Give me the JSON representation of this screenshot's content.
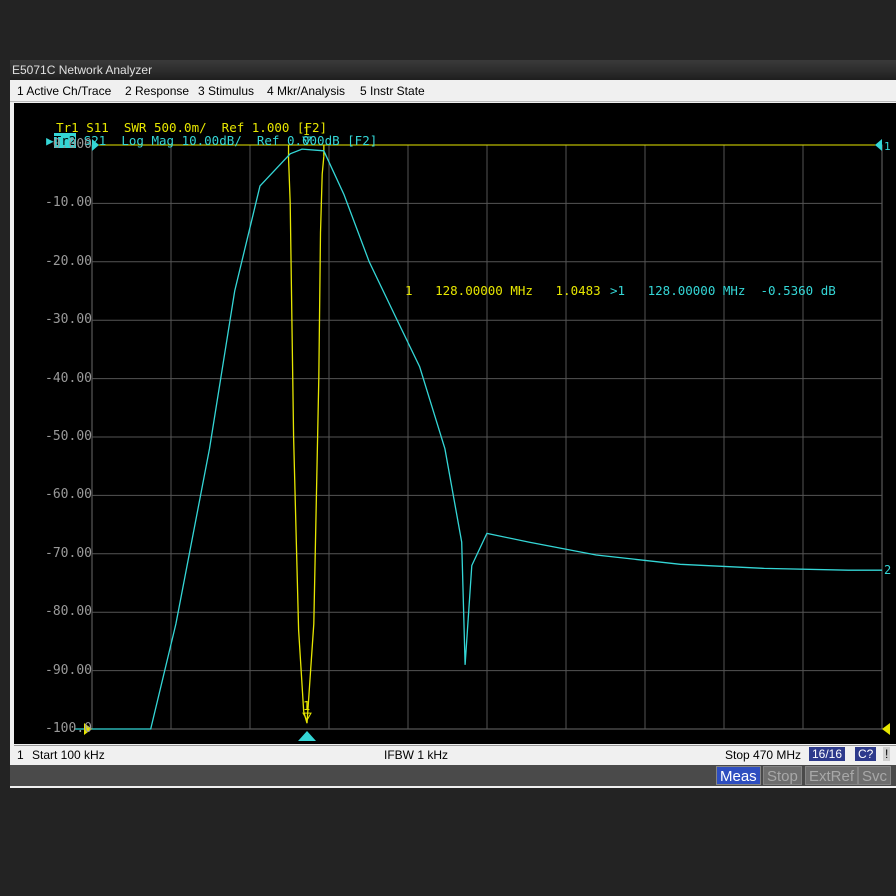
{
  "window_title": "E5071C Network Analyzer",
  "menu": [
    "1 Active Ch/Trace",
    "2 Response",
    "3 Stimulus",
    "4 Mkr/Analysis",
    "5 Instr State"
  ],
  "traces": {
    "tr1_label": "Tr1",
    "tr1_text": "S11  SWR 500.0m/  Ref 1.000 [F2]",
    "tr2_label": "Tr2",
    "tr2_text": "S21  Log Mag 10.00dB/  Ref 0.000dB [F2]"
  },
  "marker_readout": {
    "tr1": "1   128.00000 MHz   1.0483",
    "tr2": ">1   128.00000 MHz  -0.5360 dB"
  },
  "marker_labels": {
    "m1": "1",
    "end_label": "2",
    "top_right": "1"
  },
  "y_axis_labels": [
    "0.000",
    "-10.00",
    "-20.00",
    "-30.00",
    "-40.00",
    "-50.00",
    "-60.00",
    "-70.00",
    "-80.00",
    "-90.00",
    "-100.0"
  ],
  "status": {
    "channel": "1",
    "start": "Start 100 kHz",
    "ifbw": "IFBW 1 kHz",
    "stop": "Stop 470 MHz",
    "points": "16/16",
    "cal": "C?",
    "warn": "!"
  },
  "softkeys": [
    {
      "label": "Meas",
      "active": true
    },
    {
      "label": "Stop",
      "active": false
    },
    {
      "label": "ExtRef",
      "active": false
    },
    {
      "label": "Svc",
      "active": false
    }
  ],
  "colors": {
    "tr1": "#e6e600",
    "tr2": "#34d6d6",
    "grid": "#555555",
    "axis_text": "#9a9a9a"
  },
  "chart_data": {
    "type": "line",
    "x_range_mhz": [
      0.1,
      470
    ],
    "y_range_db": [
      -100,
      0
    ],
    "series": [
      {
        "name": "S21",
        "x": [
          0.1,
          35,
          50,
          70,
          85,
          100,
          118,
          125,
          138,
          150,
          165,
          180,
          195,
          210,
          220,
          222,
          226,
          235,
          260,
          300,
          350,
          400,
          450,
          470
        ],
        "y": [
          -100,
          -100,
          -82,
          -52,
          -25,
          -7,
          -1.5,
          -0.7,
          -1.0,
          -8.5,
          -20,
          -29,
          -38,
          -52,
          -68,
          -89,
          -72,
          -66.5,
          -68,
          -70.2,
          -71.8,
          -72.5,
          -72.8,
          -72.8
        ]
      },
      {
        "name": "S11",
        "x": [
          117,
          118,
          120,
          123,
          126,
          128,
          132,
          135,
          136,
          137,
          138
        ],
        "y": [
          -2,
          -10,
          -50,
          -83,
          -97,
          -99,
          -82,
          -40,
          -15,
          -5,
          -2
        ]
      }
    ],
    "marker": {
      "x_mhz": 128,
      "s11_swr": 1.0483,
      "s21_db": -0.536
    }
  }
}
